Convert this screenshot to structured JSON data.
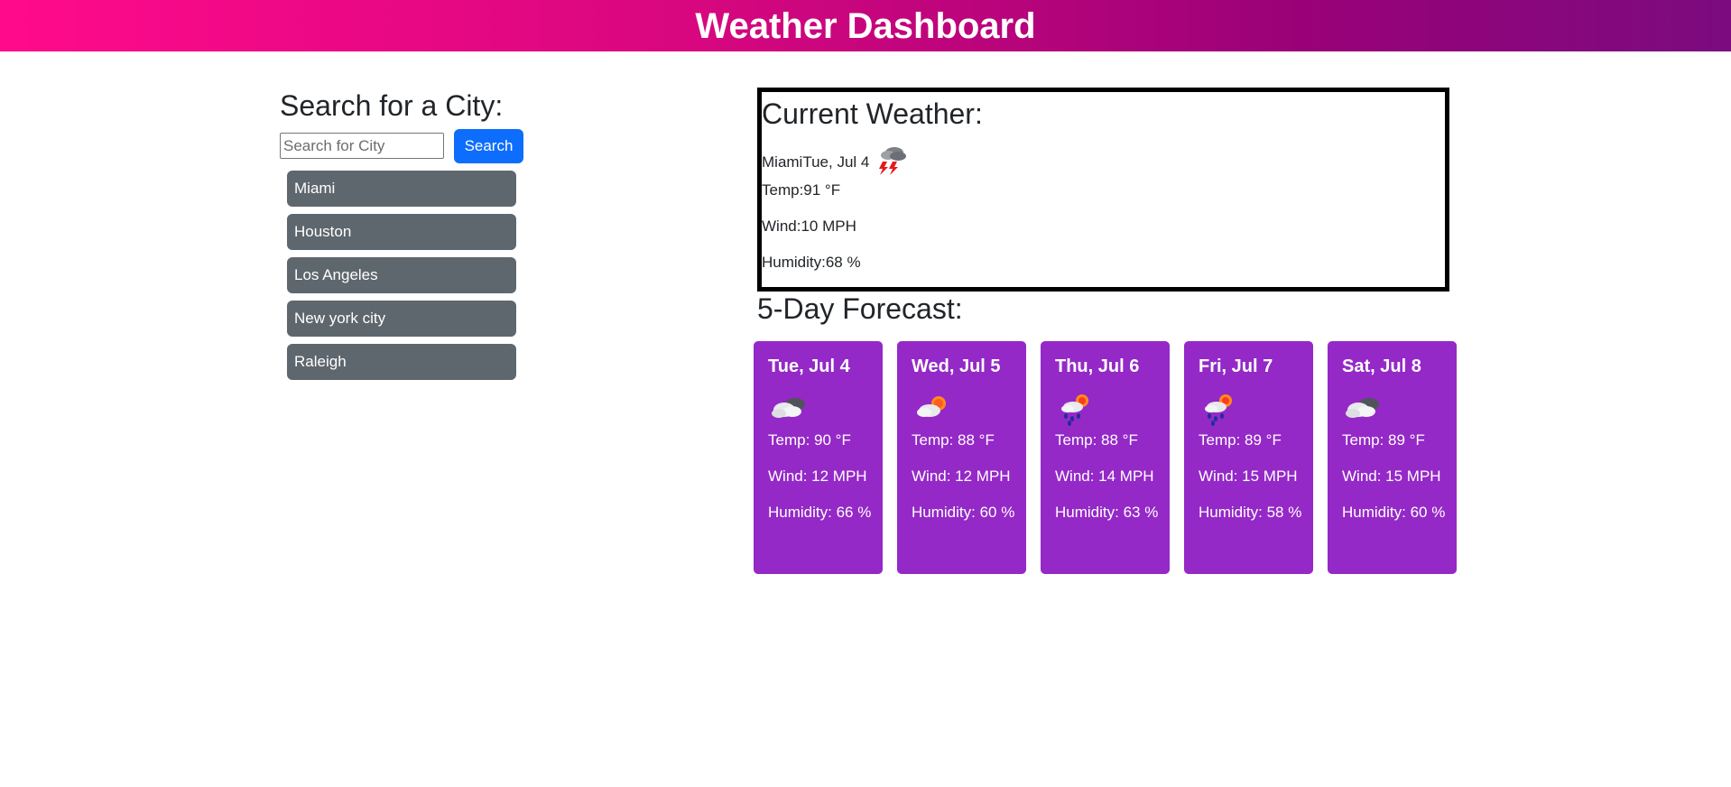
{
  "header": {
    "title": "Weather Dashboard"
  },
  "search": {
    "heading": "Search for a City:",
    "placeholder": "Search for City",
    "value": "",
    "button_label": "Search"
  },
  "history": [
    "Miami",
    "Houston",
    "Los Angeles",
    "New york city",
    "Raleigh"
  ],
  "current": {
    "heading": "Current Weather:",
    "city": "Miami",
    "date": "Tue, Jul 4",
    "icon": "thunderstorm-icon",
    "temp": "Temp:91 °F",
    "wind": "Wind:10 MPH",
    "humidity": "Humidity:68 %"
  },
  "forecast": {
    "heading": "5-Day Forecast:",
    "days": [
      {
        "date": "Tue, Jul 4",
        "icon": "overcast-clouds-icon",
        "temp": "Temp: 90 °F",
        "wind": "Wind: 12 MPH",
        "humidity": "Humidity: 66 %"
      },
      {
        "date": "Wed, Jul 5",
        "icon": "partly-cloudy-icon",
        "temp": "Temp: 88 °F",
        "wind": "Wind: 12 MPH",
        "humidity": "Humidity: 60 %"
      },
      {
        "date": "Thu, Jul 6",
        "icon": "rain-sun-icon",
        "temp": "Temp: 88 °F",
        "wind": "Wind: 14 MPH",
        "humidity": "Humidity: 63 %"
      },
      {
        "date": "Fri, Jul 7",
        "icon": "rain-sun-icon",
        "temp": "Temp: 89 °F",
        "wind": "Wind: 15 MPH",
        "humidity": "Humidity: 58 %"
      },
      {
        "date": "Sat, Jul 8",
        "icon": "overcast-clouds-icon",
        "temp": "Temp: 89 °F",
        "wind": "Wind: 15 MPH",
        "humidity": "Humidity: 60 %"
      }
    ]
  },
  "colors": {
    "header_gradient": [
      "#ff0a8a",
      "#7b0b7f"
    ],
    "card_bg": "#9429c7",
    "history_button_bg": "#5f676e",
    "search_button_bg": "#0d6efd"
  }
}
